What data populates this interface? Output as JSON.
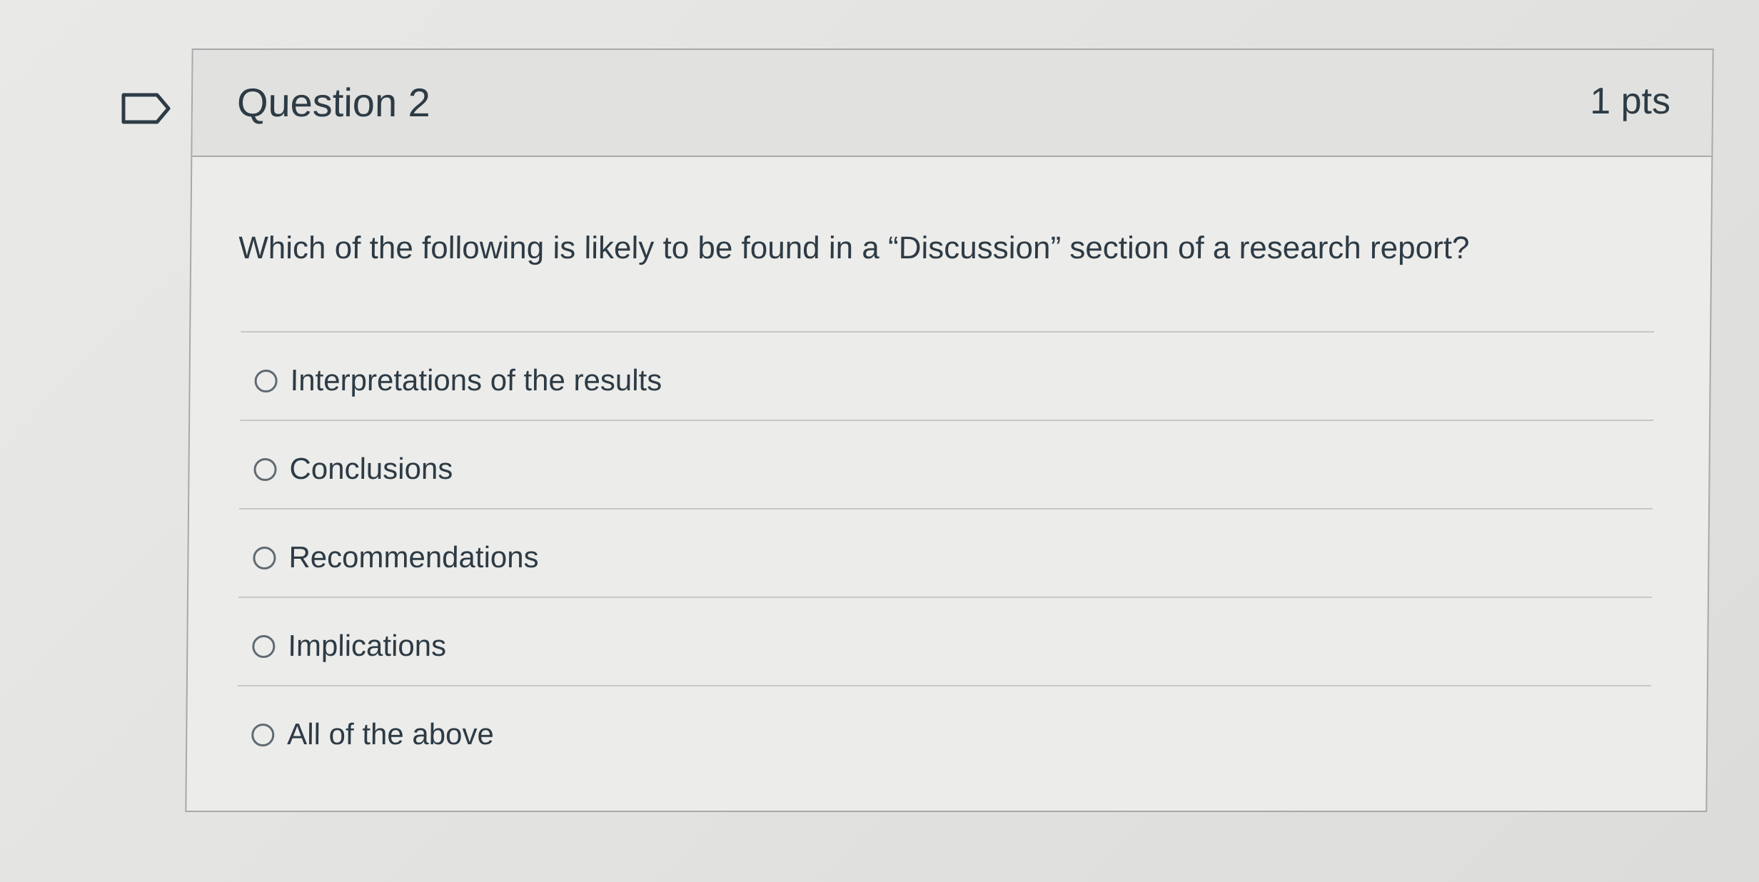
{
  "question": {
    "title": "Question 2",
    "points": "1 pts",
    "prompt": "Which of the following is likely to be found in a “Discussion” section of a research report?",
    "answers": [
      {
        "label": "Interpretations of the results",
        "selected": false
      },
      {
        "label": "Conclusions",
        "selected": false
      },
      {
        "label": "Recommendations",
        "selected": false
      },
      {
        "label": "Implications",
        "selected": false
      },
      {
        "label": "All of the above",
        "selected": false
      }
    ]
  },
  "icons": {
    "flag": "flag-question-icon",
    "radio": "radio-unselected-icon"
  },
  "colors": {
    "text": "#2d3b45",
    "border": "#a7a8aa",
    "header_bg": "#e1e1df",
    "card_bg": "#ececea"
  }
}
